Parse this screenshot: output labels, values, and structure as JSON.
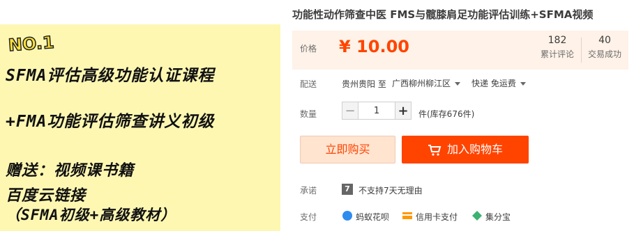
{
  "product_image": {
    "badge": "NO.1",
    "lines": [
      "SFMA评估高级功能认证课程",
      "+FMA功能评估筛查讲义初级",
      "赠送：视频课书籍",
      "百度云链接",
      "（SFMA初级+高级教材）"
    ]
  },
  "title": "功能性动作筛查中医 FMS与髋膝肩足功能评估训练+SFMA视频",
  "price": {
    "label": "价格",
    "value": "¥ 10.00",
    "reviews_count": "182",
    "reviews_label": "累计评论",
    "sales_count": "40",
    "sales_label": "交易成功"
  },
  "shipping": {
    "label": "配送",
    "from": "贵州贵阳 至",
    "to": "广西柳州柳江区",
    "method": "快递 免运费"
  },
  "quantity": {
    "label": "数量",
    "value": "1",
    "minus": "−",
    "plus": "+",
    "stock_text": "件(库存676件)"
  },
  "actions": {
    "buy_now": "立即购买",
    "add_to_cart": "加入购物车"
  },
  "promise": {
    "label": "承诺",
    "icon_glyph": "7",
    "text": "不支持7天无理由"
  },
  "payment": {
    "label": "支付",
    "methods": [
      "蚂蚁花呗",
      "信用卡支付",
      "集分宝"
    ]
  },
  "colors": {
    "accent": "#ff4400",
    "price_bg": "#fff2e8",
    "image_bg": "#fdf7b2"
  }
}
